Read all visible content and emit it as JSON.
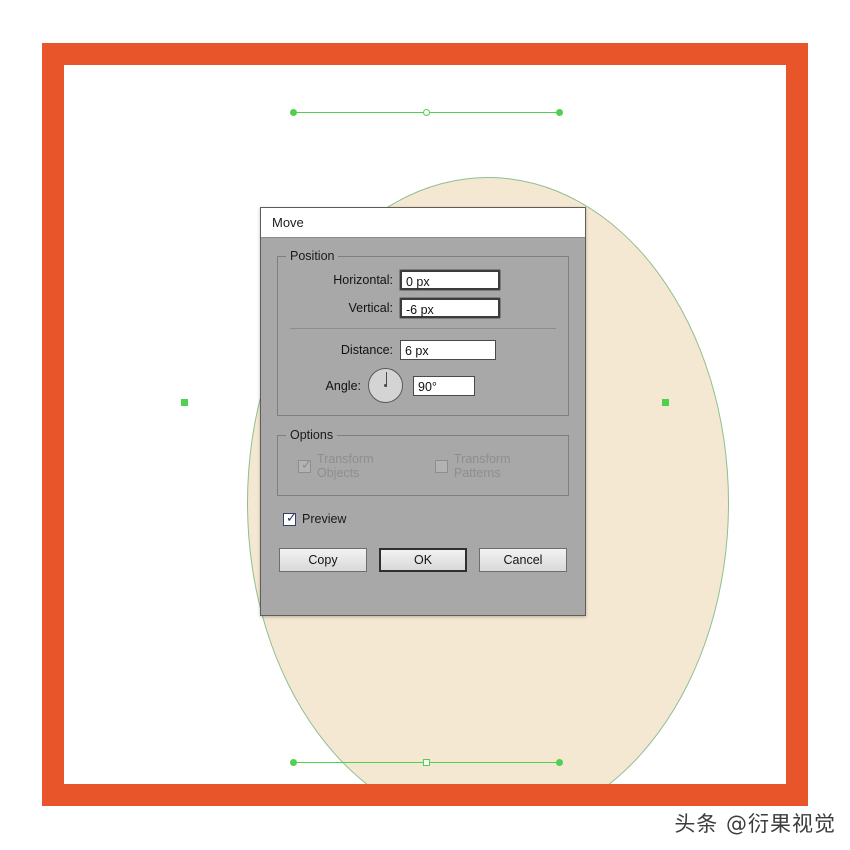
{
  "app": {
    "background_color": "#ffffff",
    "frame_color": "#e8552a"
  },
  "canvas": {
    "shape": {
      "name": "ellipse",
      "fill_color": "#f4e8d2",
      "stroke_color": "#8fbf8f",
      "selection_color": "#4fd14f"
    }
  },
  "dialog": {
    "title": "Move",
    "position_group": {
      "legend": "Position",
      "fields": [
        {
          "label": "Horizontal:",
          "value": "0 px"
        },
        {
          "label": "Vertical:",
          "value": "-6 px"
        },
        {
          "label": "Distance:",
          "value": "6 px"
        },
        {
          "label": "Angle:",
          "value": "90°"
        }
      ]
    },
    "options_group": {
      "legend": "Options",
      "transform_objects": {
        "label": "Transform Objects",
        "checked": true,
        "enabled": false,
        "mark": "✓"
      },
      "transform_patterns": {
        "label": "Transform Patterns",
        "checked": false,
        "enabled": false,
        "mark": ""
      }
    },
    "preview": {
      "label": "Preview",
      "checked": true,
      "mark": "✓"
    },
    "buttons": {
      "copy": "Copy",
      "ok": "OK",
      "cancel": "Cancel"
    }
  },
  "watermark": {
    "text": "头条 @衍果视觉"
  }
}
